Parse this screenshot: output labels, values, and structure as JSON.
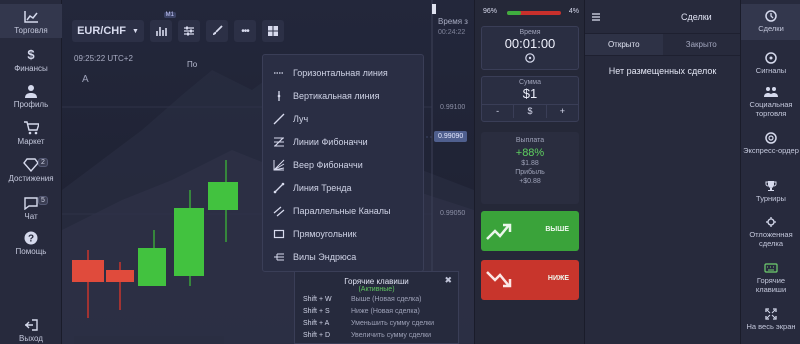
{
  "left_nav": [
    {
      "label": "Торговля",
      "icon": "chart-line-icon",
      "active": true
    },
    {
      "label": "Финансы",
      "icon": "dollar-icon"
    },
    {
      "label": "Профиль",
      "icon": "user-icon"
    },
    {
      "label": "Маркет",
      "icon": "cart-icon"
    },
    {
      "label": "Достижения",
      "icon": "diamond-icon",
      "badge": "2"
    },
    {
      "label": "Чат",
      "icon": "chat-icon",
      "badge": "5"
    },
    {
      "label": "Помощь",
      "icon": "help-icon"
    },
    {
      "label": "Выход",
      "icon": "logout-icon"
    }
  ],
  "toolbar": {
    "pair": "EUR/CHF",
    "mt_badge": "M1",
    "time": "09:25:22 UTC+2",
    "letter": "A",
    "partial_label": "По"
  },
  "price_axis": {
    "time_label": "Время з",
    "time_value": "00:24:22",
    "labels": [
      "0.99100",
      "0.99050"
    ],
    "current": "0.99090"
  },
  "drawing_menu": [
    {
      "label": "Горизонтальная линия",
      "icon": "horizontal-line-icon"
    },
    {
      "label": "Вертикальная линия",
      "icon": "vertical-line-icon"
    },
    {
      "label": "Луч",
      "icon": "ray-icon"
    },
    {
      "label": "Линии Фибоначчи",
      "icon": "fibonacci-lines-icon"
    },
    {
      "label": "Веер Фибоначчи",
      "icon": "fibonacci-fan-icon"
    },
    {
      "label": "Линия Тренда",
      "icon": "trend-line-icon"
    },
    {
      "label": "Параллельные Каналы",
      "icon": "parallel-channels-icon"
    },
    {
      "label": "Прямоугольник",
      "icon": "rectangle-icon"
    },
    {
      "label": "Вилы Эндрюса",
      "icon": "andrews-pitchfork-icon"
    }
  ],
  "hotkeys": {
    "title": "Горячие клавиши",
    "status": "(Активные)",
    "rows": [
      {
        "key": "Shift + W",
        "desc": "Выше (Новая сделка)"
      },
      {
        "key": "Shift + S",
        "desc": "Ниже (Новая сделка)"
      },
      {
        "key": "Shift + A",
        "desc": "Уменьшить сумму сделки"
      },
      {
        "key": "Shift + D",
        "desc": "Увеличить сумму сделки"
      }
    ]
  },
  "trade": {
    "balance_left": "96%",
    "balance_right": "4%",
    "balance_fraction": 0.25,
    "time_label": "Время",
    "time_value": "00:01:00",
    "sum_label": "Сумма",
    "sum_value": "$1",
    "minus": "-",
    "dollar": "$",
    "plus": "+",
    "payout_label": "Выплата",
    "payout_pct": "+88%",
    "payout_amount": "$1.88",
    "profit_label": "Прибыль",
    "profit_amount": "+$0.88",
    "up_label": "ВЫШЕ",
    "down_label": "НИЖЕ"
  },
  "deals": {
    "title": "Сделки",
    "tab_open": "Открыто",
    "tab_closed": "Закрыто",
    "empty": "Нет размещенных сделок"
  },
  "right_nav": [
    {
      "label": "Сделки",
      "icon": "history-icon",
      "active": true
    },
    {
      "label": "Сигналы",
      "icon": "signals-icon"
    },
    {
      "label": "Социальная торговля",
      "icon": "social-trading-icon"
    },
    {
      "label": "Экспресс-ордер",
      "icon": "express-order-icon"
    },
    {
      "label": "Турниры",
      "icon": "trophy-icon"
    },
    {
      "label": "Отложенная сделка",
      "icon": "pending-trade-icon"
    },
    {
      "label": "Горячие клавиши",
      "icon": "keyboard-icon"
    },
    {
      "label": "На весь экран",
      "icon": "fullscreen-icon"
    }
  ],
  "colors": {
    "up": "#3aa33a",
    "down": "#c8352c",
    "accent": "#4f5f8e"
  }
}
